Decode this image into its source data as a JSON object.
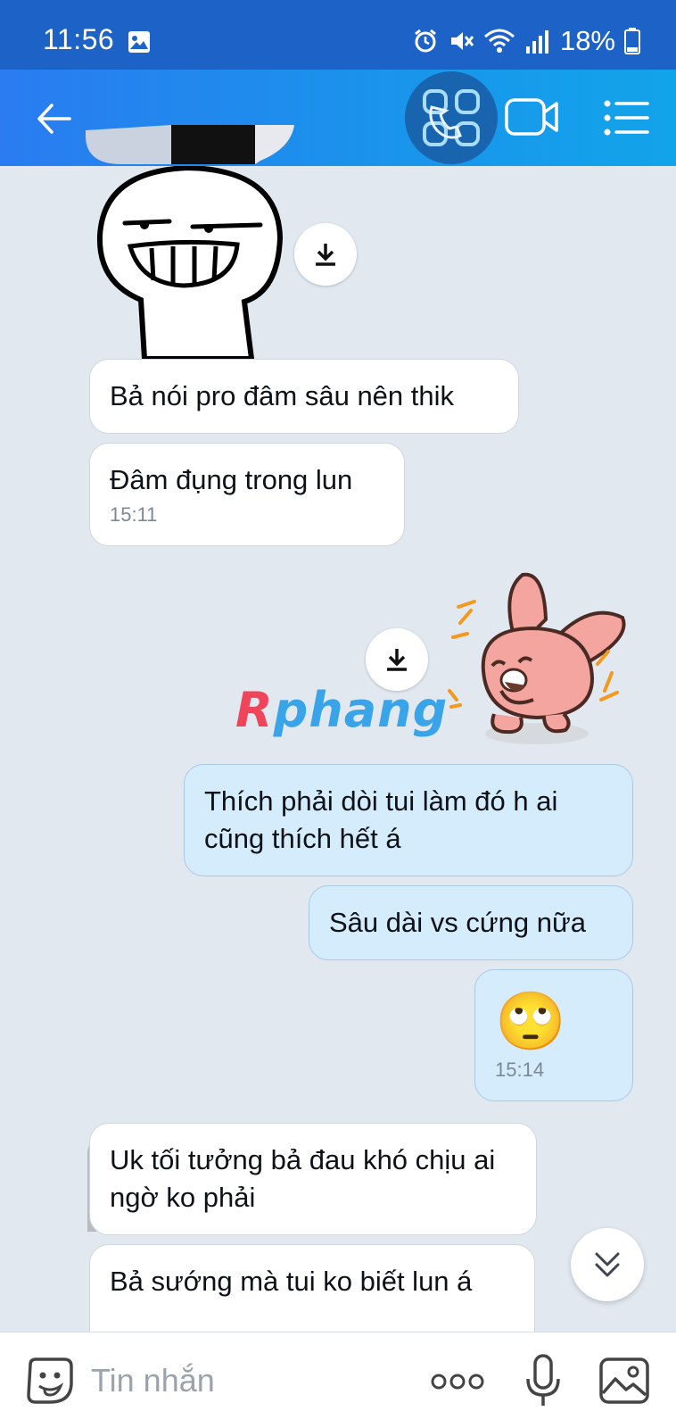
{
  "status": {
    "time": "11:56",
    "battery": "18%"
  },
  "header": {
    "back_icon": "arrow-left-icon",
    "call_icon": "phone-icon",
    "video_icon": "video-camera-icon",
    "menu_icon": "list-menu-icon"
  },
  "chat": {
    "messages": [
      {
        "text": "Bả nói pro đâm sâu nên thik"
      },
      {
        "text": "Đâm đụng trong lun",
        "time": "15:11"
      },
      {
        "text": "Thích phải dòi tui làm đó h ai cũng thích hết á"
      },
      {
        "text": "Sâu dài vs cứng nữa"
      },
      {
        "text": "🙄",
        "time": "15:14"
      },
      {
        "text": "Uk tối tưởng bả đau khó chịu ai ngờ ko phải"
      },
      {
        "text": "Bả sướng mà tui ko biết lun á"
      }
    ],
    "watermark_initial": "R",
    "watermark_rest": "phang"
  },
  "input": {
    "placeholder": "Tin nhắn"
  },
  "colors": {
    "header": "#1a93ec",
    "status_bar": "#1d63c7",
    "chat_background": "#e2e8f0",
    "outgoing_bubble": "#d5ecfd",
    "incoming_bubble": "#ffffff"
  }
}
